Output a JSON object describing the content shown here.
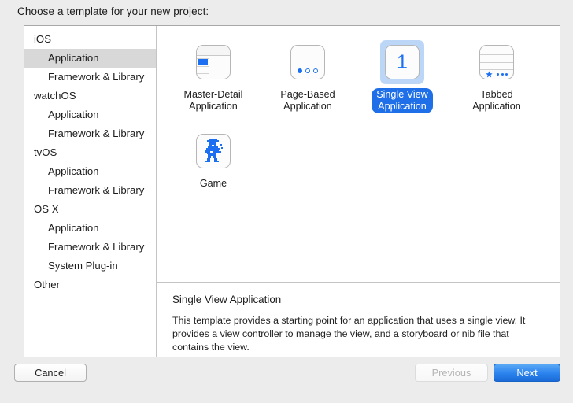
{
  "prompt": "Choose a template for your new project:",
  "sidebar": {
    "items": [
      {
        "label": "iOS",
        "type": "group",
        "selected": false
      },
      {
        "label": "Application",
        "type": "child",
        "selected": true
      },
      {
        "label": "Framework & Library",
        "type": "child",
        "selected": false
      },
      {
        "label": "watchOS",
        "type": "group",
        "selected": false
      },
      {
        "label": "Application",
        "type": "child",
        "selected": false
      },
      {
        "label": "Framework & Library",
        "type": "child",
        "selected": false
      },
      {
        "label": "tvOS",
        "type": "group",
        "selected": false
      },
      {
        "label": "Application",
        "type": "child",
        "selected": false
      },
      {
        "label": "Framework & Library",
        "type": "child",
        "selected": false
      },
      {
        "label": "OS X",
        "type": "group",
        "selected": false
      },
      {
        "label": "Application",
        "type": "child",
        "selected": false
      },
      {
        "label": "Framework & Library",
        "type": "child",
        "selected": false
      },
      {
        "label": "System Plug-in",
        "type": "child",
        "selected": false
      },
      {
        "label": "Other",
        "type": "group",
        "selected": false
      }
    ]
  },
  "templates": [
    {
      "label": "Master-Detail\nApplication",
      "line1": "Master-Detail",
      "line2": "Application",
      "icon": "master-detail-icon",
      "selected": false
    },
    {
      "label": "Page-Based\nApplication",
      "line1": "Page-Based",
      "line2": "Application",
      "icon": "page-based-icon",
      "selected": false
    },
    {
      "label": "Single View\nApplication",
      "line1": "Single View",
      "line2": "Application",
      "icon": "single-view-icon",
      "selected": true
    },
    {
      "label": "Tabbed\nApplication",
      "line1": "Tabbed",
      "line2": "Application",
      "icon": "tabbed-icon",
      "selected": false
    },
    {
      "label": "Game",
      "line1": "Game",
      "line2": "",
      "icon": "game-sprite-icon",
      "selected": false
    }
  ],
  "single_view_badge": "1",
  "description": {
    "title": "Single View Application",
    "body": "This template provides a starting point for an application that uses a single view. It provides a view controller to manage the view, and a storyboard or nib file that contains the view."
  },
  "footer": {
    "cancel_label": "Cancel",
    "previous_label": "Previous",
    "next_label": "Next"
  },
  "colors": {
    "accent_blue": "#1b6ff0",
    "selection_blue": "#1f6fe8",
    "icon_highlight": "#bcd6f7",
    "sidebar_selection": "#d8d8d8",
    "window_bg": "#ececec"
  }
}
